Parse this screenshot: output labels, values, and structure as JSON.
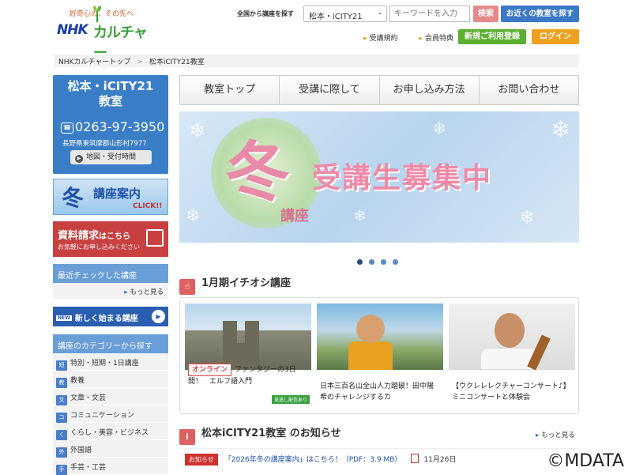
{
  "header": {
    "tagline": "好奇心の、その先へ",
    "logo_nhk": "NHK",
    "logo_brand": "カルチャー",
    "search_label": "全国から講座を探す",
    "school_select": "松本・iCITY21",
    "keyword_placeholder": "キーワードを入力",
    "search_button": "検索",
    "nearby_button": "お近くの教室を探す",
    "terms_link": "受講規約",
    "member_link": "会員特典",
    "register_button": "新規ご利用登録",
    "login_button": "ログイン"
  },
  "breadcrumb": {
    "home": "NHKカルチャートップ",
    "separator": ">",
    "current": "松本iCITY21教室"
  },
  "sidebar": {
    "school_name": "松本・iCITY21教室",
    "phone": "0263-97-3950",
    "address": "長野県東筑摩郡山形村7977",
    "map_button": "地図・受付時間",
    "winter_kanji": "冬",
    "winter_text": "講座案内",
    "winter_click": "CLICK!!",
    "doc_title": "資料請求",
    "doc_title_small": "はこちら",
    "doc_sub": "お気軽にお申し込みください",
    "recent_title": "最近チェックした講座",
    "more": "もっと見る",
    "new_badge": "NEW",
    "new_courses": "新しく始まる講座",
    "category_title": "講座のカテゴリーから探す",
    "categories": [
      {
        "icon": "短",
        "label": "特別・短期・1日講座"
      },
      {
        "icon": "教",
        "label": "教養"
      },
      {
        "icon": "文",
        "label": "文章・文芸"
      },
      {
        "icon": "コ",
        "label": "コミュニケーション"
      },
      {
        "icon": "く",
        "label": "くらし・美容・ビジネス"
      },
      {
        "icon": "外",
        "label": "外国語"
      },
      {
        "icon": "手",
        "label": "手芸・工芸"
      }
    ]
  },
  "tabs": [
    "教室トップ",
    "受講に際して",
    "お申し込み方法",
    "お問い合わせ"
  ],
  "hero": {
    "season": "冬",
    "koza": "講座",
    "headline": "受講生募集中"
  },
  "carousel": {
    "count": 4,
    "active": 0
  },
  "featured": {
    "title": "1月期イチオシ講座",
    "courses": [
      {
        "badge": "オンライン",
        "caption": "ファンタジーの3日間！　エルフ語入門",
        "tag": "見逃し配信あり"
      },
      {
        "caption": "日本三百名山全山人力踏破！田中陽希のチャレンジするカ"
      },
      {
        "caption": "【ウクレレレクチャーコンサート♪】　ミニコンサートと体験会"
      }
    ]
  },
  "news": {
    "title": "松本iCITY21教室 のお知らせ",
    "more": "もっと見る",
    "items": [
      {
        "badge": "お知らせ",
        "text": "「2026年冬の講座案内」はこちら！（PDF：3.9 MB）",
        "date": "11月26日"
      }
    ]
  },
  "watermark": "©MDATA",
  "colors": {
    "primary": "#3a7ec8",
    "accent_red": "#d03030",
    "green": "#5cb030",
    "orange": "#f0a020"
  }
}
